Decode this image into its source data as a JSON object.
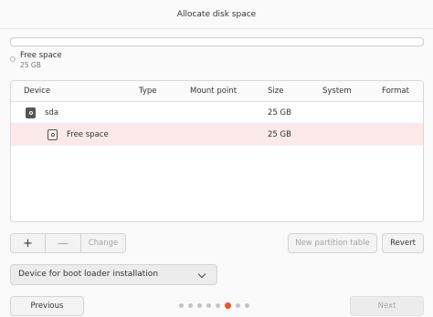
{
  "window": {
    "title": "Allocate disk space"
  },
  "usage": {
    "legend": {
      "name": "Free space",
      "size": "25 GB"
    },
    "free_fraction": 1.0
  },
  "table": {
    "headers": {
      "device": "Device",
      "type": "Type",
      "mount_point": "Mount point",
      "size": "Size",
      "system": "System",
      "format": "Format"
    },
    "disk": {
      "device": "sda",
      "size": "25 GB",
      "icon": "drive-icon"
    },
    "partition": {
      "device": "Free space",
      "size": "25 GB",
      "icon": "drive-icon",
      "selected": true
    }
  },
  "actions": {
    "add": "+",
    "remove": "—",
    "change": "Change",
    "new_partition_table": "New partition table",
    "revert": "Revert"
  },
  "bootloader": {
    "label": "Device for boot loader installation"
  },
  "navigation": {
    "previous": "Previous",
    "next": "Next",
    "step_count": 8,
    "current_step": 6
  },
  "colors": {
    "accent": "#e95420",
    "selection": "#fbeae8"
  }
}
